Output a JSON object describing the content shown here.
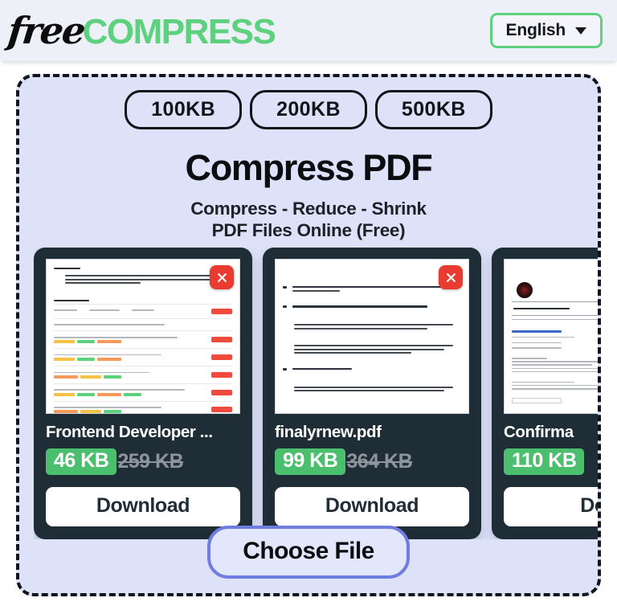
{
  "header": {
    "logo_free": "free",
    "logo_compress": "COMPRESS",
    "language_label": "English",
    "caret_icon": "chevron-down-icon",
    "accent_green": "#5ed17f",
    "background": "#edf0f7"
  },
  "dropzone": {
    "background": "#dde2f8",
    "border_color": "#111418"
  },
  "size_presets": [
    {
      "label": "100KB"
    },
    {
      "label": "200KB"
    },
    {
      "label": "500KB"
    }
  ],
  "headline": "Compress PDF",
  "subline_line1": "Compress - Reduce - Shrink",
  "subline_line2": "PDF Files Online (Free)",
  "cards": [
    {
      "file_name": "Frontend Developer ...",
      "new_size": "46 KB",
      "old_size": "259 KB",
      "download_label": "Download",
      "close_icon": "close-icon",
      "thumbnail_kind": "assignment-document"
    },
    {
      "file_name": "finalyrnew.pdf",
      "new_size": "99 KB",
      "old_size": "364 KB",
      "download_label": "Download",
      "close_icon": "close-icon",
      "thumbnail_kind": "project-objectives-document"
    },
    {
      "file_name": "Confirma",
      "new_size": "110 KB",
      "old_size": "",
      "download_label": "Dow",
      "close_icon": "close-icon",
      "thumbnail_kind": "application-form-document"
    }
  ],
  "choose_file_label": "Choose File",
  "colors": {
    "badge_green": "#4cbf6e",
    "card_dark": "#1f2d37",
    "close_red": "#ea3b30",
    "choose_border": "#6f7de0",
    "old_size_gray": "#8e949c"
  }
}
